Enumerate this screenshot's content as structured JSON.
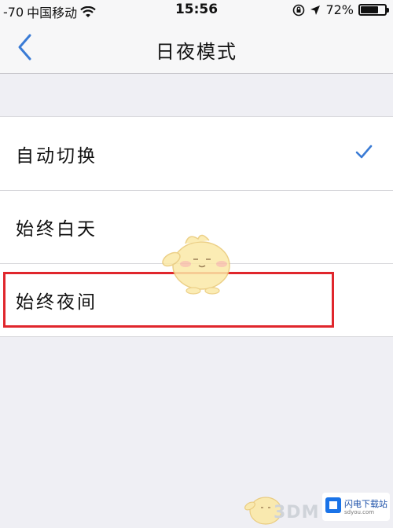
{
  "status_bar": {
    "signal": "-70",
    "carrier": "中国移动",
    "time": "15:56",
    "battery": "72%",
    "battery_level": 0.72
  },
  "nav": {
    "title": "日夜模式"
  },
  "options": [
    {
      "label": "自动切换",
      "selected": true
    },
    {
      "label": "始终白天",
      "selected": false
    },
    {
      "label": "始终夜间",
      "selected": false,
      "highlighted": true
    }
  ],
  "watermark": {
    "brand": "3DM",
    "badge_text": "闪电下载站",
    "badge_sub": "sdyou.com"
  },
  "colors": {
    "accent": "#3a7bd5",
    "highlight_box": "#e0262c",
    "background": "#efeff4"
  }
}
